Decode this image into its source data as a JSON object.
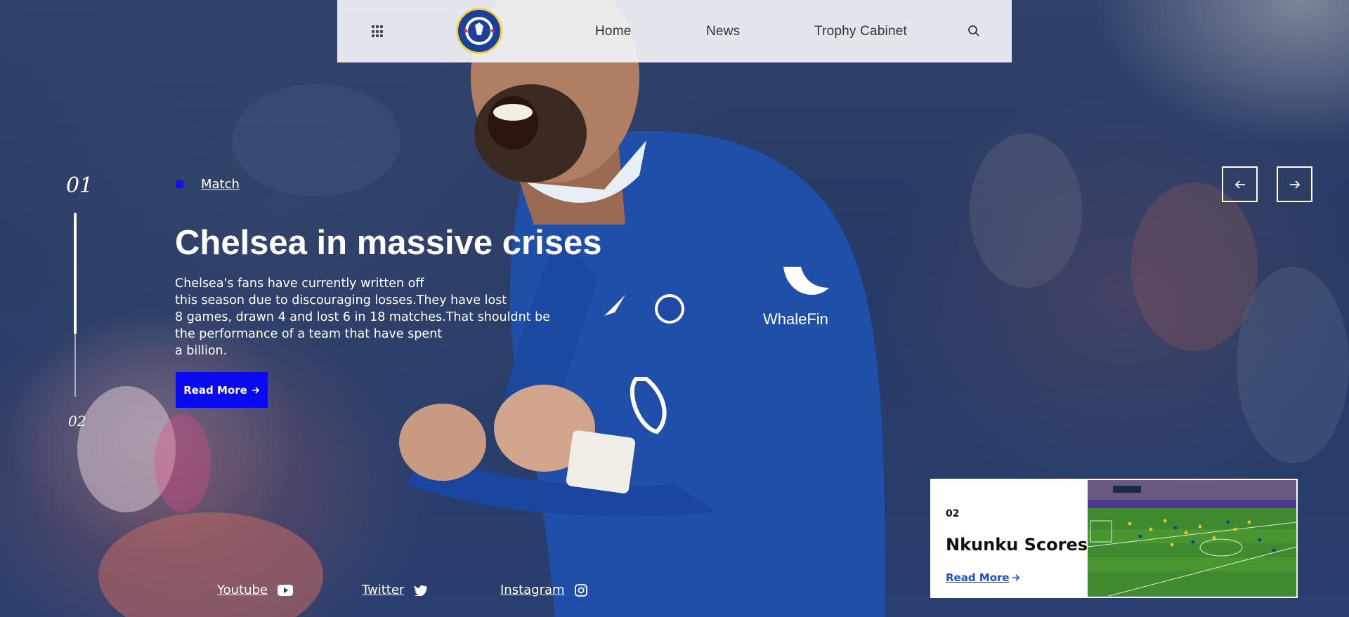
{
  "nav": {
    "links": [
      "Home",
      "News",
      "Trophy Cabinet"
    ],
    "logo_text_top": "CHELSEA",
    "logo_text_bottom": "FOOTBALL CLUB"
  },
  "slider": {
    "current_index": "01",
    "next_index": "02",
    "progress": 0.66
  },
  "hero": {
    "category": "Match",
    "title": "Chelsea in massive crises",
    "body_lines": [
      "Chelsea's fans have currently written off",
      "this season due to discouraging losses.They have lost",
      "8 games, drawn 4 and lost 6 in 18 matches.That shouldnt be",
      "the performance of a team that have spent",
      "a billion."
    ],
    "button_label": "Read More",
    "shirt_sponsor": "WhaleFin"
  },
  "social": [
    {
      "label": "Youtube",
      "icon": "youtube-icon"
    },
    {
      "label": "Twitter",
      "icon": "twitter-icon"
    },
    {
      "label": "Instagram",
      "icon": "instagram-icon"
    }
  ],
  "next_card": {
    "number": "02",
    "title": "Nkunku Scores",
    "link_label": "Read More"
  },
  "colors": {
    "accent": "#0a0af0",
    "nav_bg": "#f0f3f6",
    "link_blue": "#1a4fd0"
  }
}
